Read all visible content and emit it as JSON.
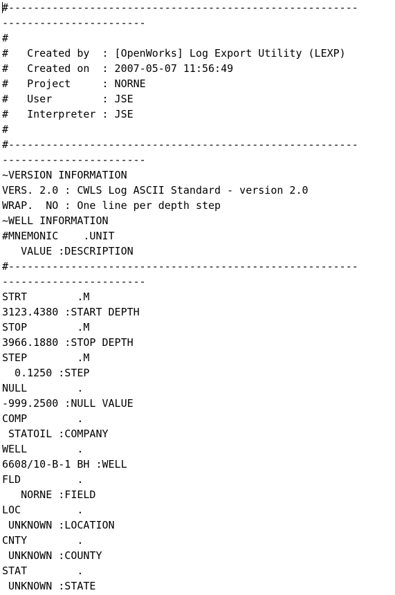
{
  "lines": [
    "#--------------------------------------------------------",
    "-----------------------",
    "#",
    "#   Created by  : [OpenWorks] Log Export Utility (LEXP)",
    "#   Created on  : 2007-05-07 11:56:49",
    "#   Project     : NORNE",
    "#   User        : JSE",
    "#   Interpreter : JSE",
    "#",
    "#--------------------------------------------------------",
    "-----------------------",
    "~VERSION INFORMATION",
    "VERS. 2.0 : CWLS Log ASCII Standard - version 2.0",
    "WRAP.  NO : One line per depth step",
    "~WELL INFORMATION",
    "#MNEMONIC    .UNIT",
    "   VALUE :DESCRIPTION",
    "#--------------------------------------------------------",
    "-----------------------",
    "STRT        .M",
    "3123.4380 :START DEPTH",
    "STOP        .M",
    "3966.1880 :STOP DEPTH",
    "STEP        .M",
    "  0.1250 :STEP",
    "NULL        .",
    "-999.2500 :NULL VALUE",
    "COMP        .",
    " STATOIL :COMPANY",
    "WELL        .",
    "6608/10-B-1 BH :WELL",
    "FLD         .",
    "   NORNE :FIELD",
    "LOC         .",
    " UNKNOWN :LOCATION",
    "CNTY        .",
    " UNKNOWN :COUNTY",
    "STAT        .",
    " UNKNOWN :STATE"
  ]
}
